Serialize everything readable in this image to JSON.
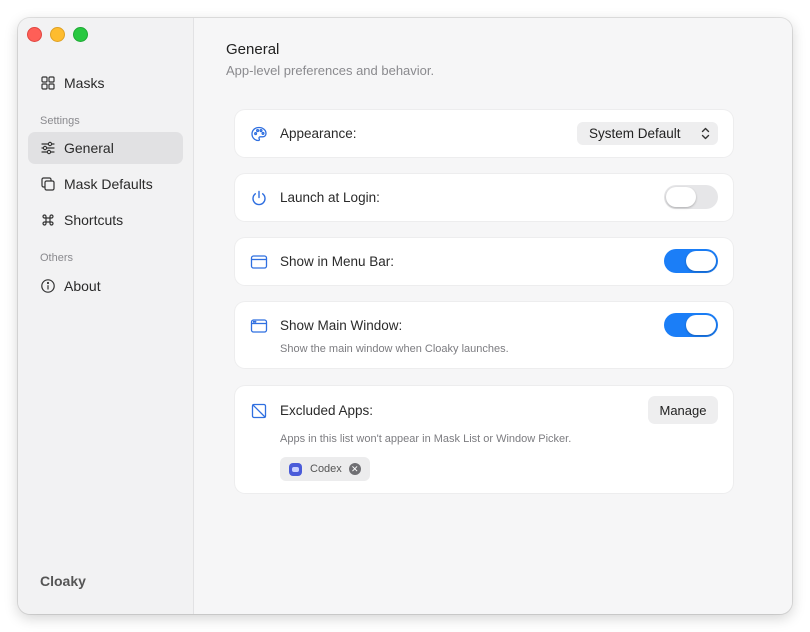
{
  "app_name": "Cloaky",
  "sidebar": {
    "top_items": [
      {
        "label": "Masks",
        "icon": "grid-icon"
      }
    ],
    "sections": [
      {
        "label": "Settings",
        "items": [
          {
            "label": "General",
            "icon": "sliders-icon",
            "active": true
          },
          {
            "label": "Mask Defaults",
            "icon": "copy-icon",
            "active": false
          },
          {
            "label": "Shortcuts",
            "icon": "command-icon",
            "active": false
          }
        ]
      },
      {
        "label": "Others",
        "items": [
          {
            "label": "About",
            "icon": "info-icon",
            "active": false
          }
        ]
      }
    ],
    "footer": "Cloaky"
  },
  "main": {
    "title": "General",
    "subtitle": "App-level preferences and behavior.",
    "appearance": {
      "label": "Appearance:",
      "value": "System Default",
      "icon": "palette-icon"
    },
    "launch_at_login": {
      "label": "Launch at Login:",
      "on": false,
      "icon": "power-icon"
    },
    "show_in_menu_bar": {
      "label": "Show in Menu Bar:",
      "on": true,
      "icon": "window-icon"
    },
    "show_main_window": {
      "label": "Show Main Window:",
      "description": "Show the main window when Cloaky launches.",
      "on": true,
      "icon": "window-icon"
    },
    "excluded_apps": {
      "label": "Excluded Apps:",
      "description": "Apps in this list won't appear in Mask List or Window Picker.",
      "button": "Manage",
      "icon": "excluded-icon",
      "apps": [
        {
          "name": "Codex",
          "remove_glyph": "✕"
        }
      ]
    }
  },
  "colors": {
    "accent": "#1b7ef7",
    "icon_blue": "#2f6fe0"
  }
}
